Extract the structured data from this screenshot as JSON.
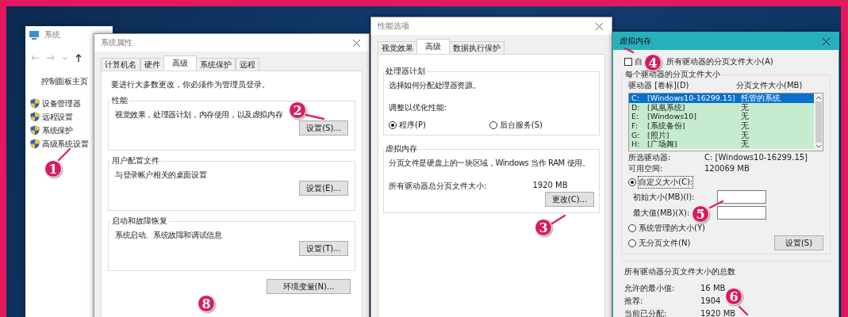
{
  "system_window": {
    "title": "系统",
    "home_link": "控制面板主页",
    "links": [
      "设备管理器",
      "远程设置",
      "系统保护",
      "高级系统设置"
    ]
  },
  "system_properties": {
    "title": "系统属性",
    "tabs": [
      {
        "label": "计算机名",
        "selected": false
      },
      {
        "label": "硬件",
        "selected": false
      },
      {
        "label": "高级",
        "selected": true
      },
      {
        "label": "系统保护",
        "selected": false
      },
      {
        "label": "远程",
        "selected": false
      }
    ],
    "admin_note": "要进行大多数更改，你必须作为管理员登录。",
    "groups": [
      {
        "title": "性能",
        "description": "视觉效果，处理器计划，内存使用，以及虚拟内存",
        "button": "设置(S)..."
      },
      {
        "title": "用户配置文件",
        "description": "与登录帐户相关的桌面设置",
        "button": "设置(E)..."
      },
      {
        "title": "启动和故障恢复",
        "description": "系统启动、系统故障和调试信息",
        "button": "设置(T)..."
      }
    ],
    "env_button": "环境变量(N)..."
  },
  "performance_options": {
    "title": "性能选项",
    "tabs": [
      {
        "label": "视觉效果",
        "selected": false
      },
      {
        "label": "高级",
        "selected": true
      },
      {
        "label": "数据执行保护",
        "selected": false
      }
    ],
    "processor_group": {
      "title": "处理器计划",
      "description": "选择如何分配处理器资源。",
      "adjust_label": "调整以优化性能:",
      "options": [
        {
          "label": "程序(P)",
          "selected": true
        },
        {
          "label": "后台服务(S)",
          "selected": false
        }
      ]
    },
    "virtual_memory_group": {
      "title": "虚拟内存",
      "description": "分页文件是硬盘上的一块区域，Windows 当作 RAM 使用。",
      "total_label": "所有驱动器总分页文件大小:",
      "total_value": "1920 MB",
      "button": "更改(C)..."
    }
  },
  "virtual_memory": {
    "title": "虚拟内存",
    "auto_manage": {
      "checked": false,
      "label_start": "自",
      "label_end": "所有驱动器的分页文件大小(A)"
    },
    "per_drive_group": {
      "title": "每个驱动器的分页文件大小",
      "columns": [
        "驱动器 [卷标](D)",
        "分页文件大小(MB)"
      ],
      "drives": [
        {
          "letter": "C:",
          "label": "[Windows10-16299.15]",
          "size": "托管的系统",
          "selected": true
        },
        {
          "letter": "D:",
          "label": "[凤凰系统]",
          "size": "无",
          "selected": false
        },
        {
          "letter": "E:",
          "label": "[Windows10]",
          "size": "无",
          "selected": false
        },
        {
          "letter": "F:",
          "label": "[系统备份]",
          "size": "无",
          "selected": false
        },
        {
          "letter": "G:",
          "label": "[照片]",
          "size": "无",
          "selected": false
        },
        {
          "letter": "H:",
          "label": "[广场舞]",
          "size": "无",
          "selected": false
        }
      ],
      "selected_drive_label": "所选驱动器:",
      "selected_drive_value": "C:  [Windows10-16299.15]",
      "free_space_label": "可用空间:",
      "free_space_value": "120069 MB",
      "custom_size": {
        "label": "自定义大小(C):",
        "selected": true
      },
      "initial_size_label": "初始大小(MB)(I):",
      "max_size_label": "最大值(MB)(X):",
      "system_managed": {
        "label": "系统管理的大小(Y)",
        "selected": false
      },
      "no_paging": {
        "label": "无分页文件(N)",
        "selected": false
      },
      "set_button": "设置(S)"
    },
    "totals": {
      "title": "所有驱动器分页文件大小的总数",
      "rows": [
        {
          "label": "允许的最小值:",
          "value": "16 MB"
        },
        {
          "label": "推荐:",
          "value": "1904"
        },
        {
          "label": "当前已分配:",
          "value": "1920 MB"
        }
      ]
    }
  },
  "markers": [
    "1",
    "2",
    "3",
    "4",
    "5",
    "6",
    "8"
  ]
}
